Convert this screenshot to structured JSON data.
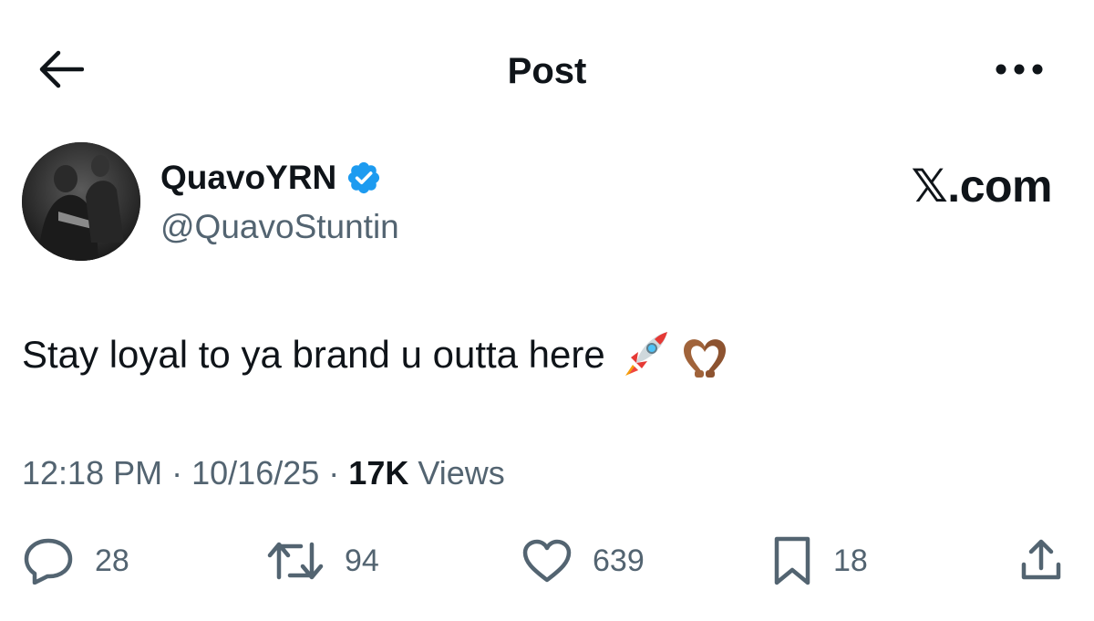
{
  "header": {
    "title": "Post",
    "back_icon": "arrow-left-icon",
    "more_icon": "more-dots-icon"
  },
  "author": {
    "display_name": "QuavoYRN",
    "handle": "@QuavoStuntin",
    "verified": true,
    "verified_color": "#1d9bf0"
  },
  "watermark": "𝕏.com",
  "post": {
    "text": "Stay loyal to ya brand u outta here",
    "emojis": [
      "rocket-emoji",
      "heart-hands-emoji"
    ]
  },
  "meta": {
    "time": "12:18 PM",
    "separator": "·",
    "date": "10/16/25",
    "views_count": "17K",
    "views_label": "Views"
  },
  "actions": {
    "replies": "28",
    "reposts": "94",
    "likes": "639",
    "bookmarks": "18"
  },
  "colors": {
    "text_primary": "#0f1419",
    "text_secondary": "#536471",
    "accent": "#1d9bf0"
  }
}
